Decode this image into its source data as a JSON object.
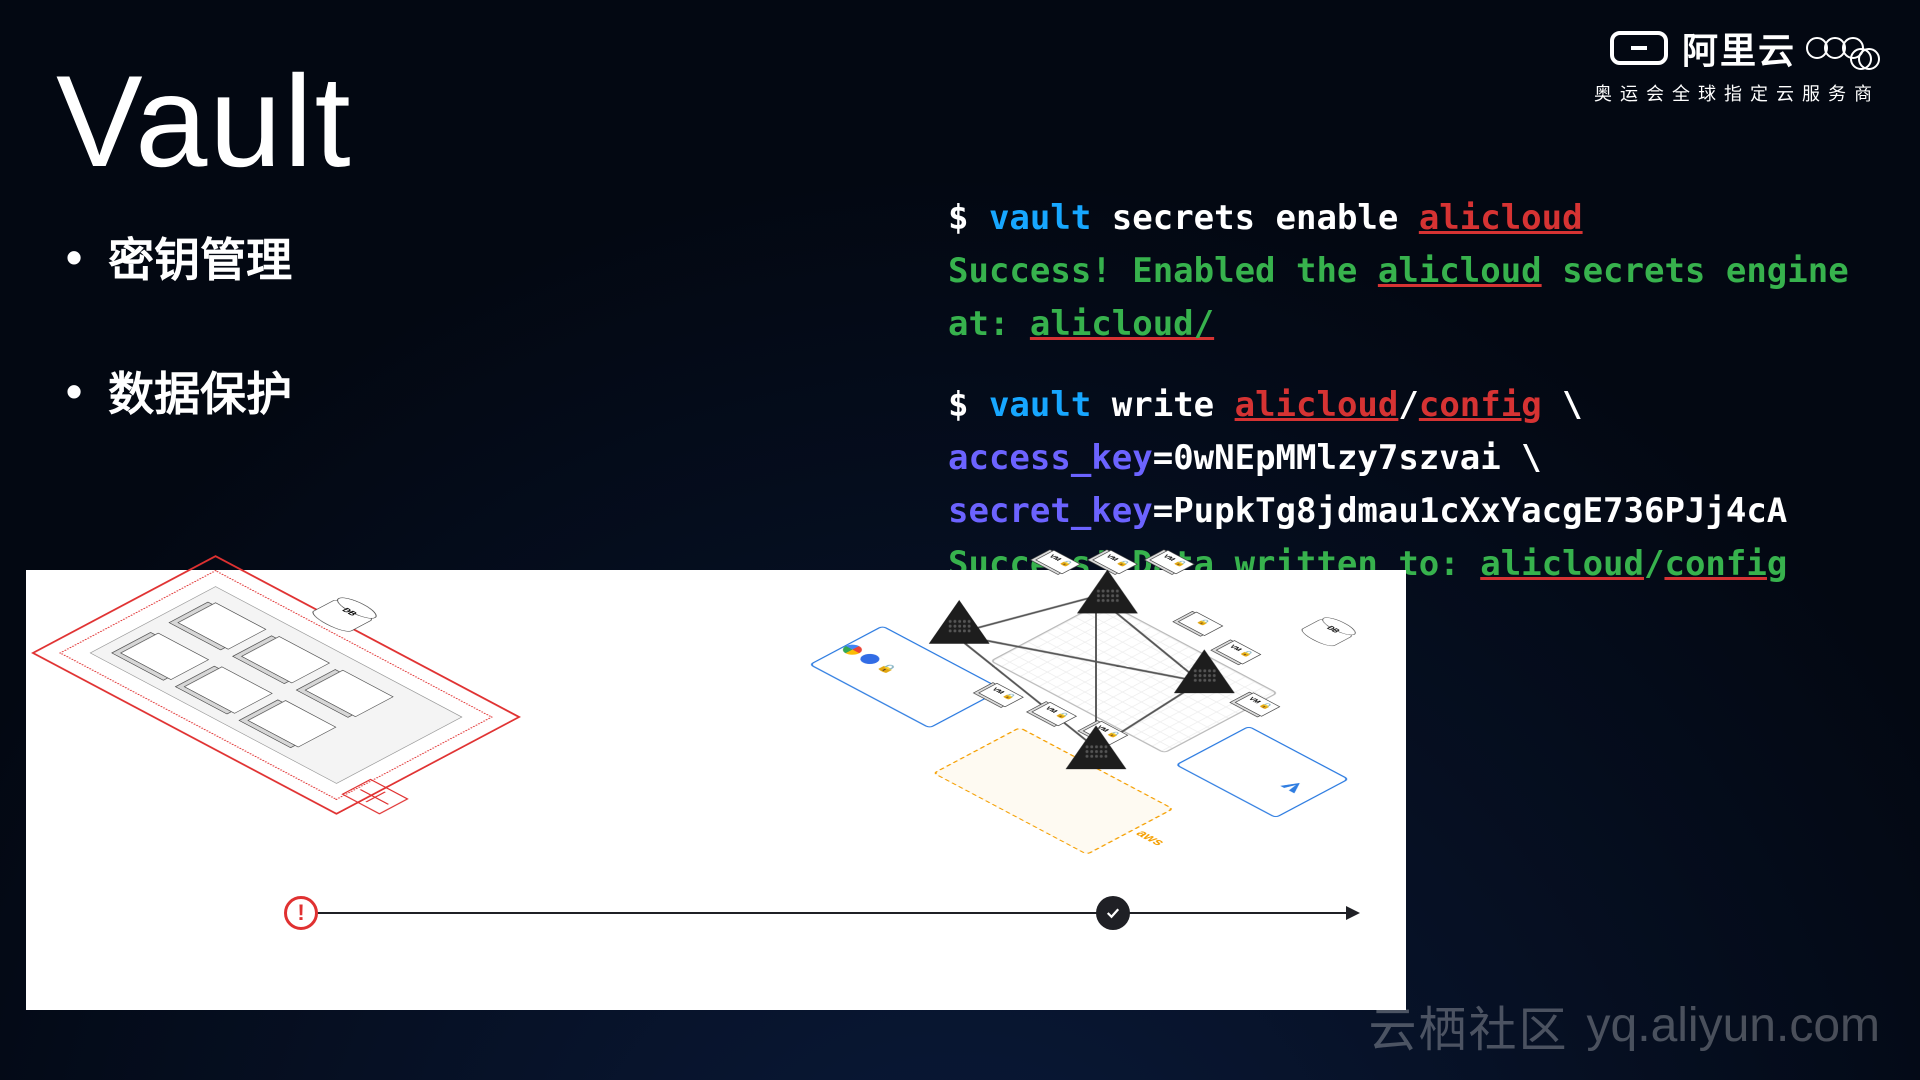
{
  "title": "Vault",
  "bullets": [
    "密钥管理",
    "数据保护"
  ],
  "terminal": {
    "line1": {
      "prompt": "$ ",
      "cmd": "vault",
      "rest": " secrets enable ",
      "ali": "alicloud"
    },
    "line2": {
      "pre": "Success! Enabled the ",
      "ali": "alicloud",
      "post": " secrets engine at: ",
      "ali2": "alicloud/"
    },
    "line3": {
      "prompt": "$ ",
      "cmd": "vault",
      "rest": " write ",
      "ali": "alicloud",
      "slash": "/",
      "cfg": "config",
      "cont": " \\"
    },
    "line4": {
      "indent": "        ",
      "key": "access_key",
      "eq": "=",
      "val": "0wNEpMMlzy7szvai",
      "cont": " \\"
    },
    "line5": {
      "indent": "        ",
      "key": "secret_key",
      "eq": "=",
      "val": "PupkTg8jdmau1cXxYacgE736PJj4cA"
    },
    "line6": {
      "pre": "Success! Data written to: ",
      "ali": "alicloud",
      "slash": "/",
      "cfg": "config"
    }
  },
  "logo": {
    "brand": "阿里云",
    "tagline": "奥运会全球指定云服务商"
  },
  "watermark": {
    "cn": "云栖社区",
    "url": "yq.aliyun.com"
  },
  "diagram": {
    "db_label": "DB",
    "vm_label": "VM",
    "aws_label": "aws",
    "stop_a": "!",
    "gcp_color1": "#ea4335",
    "gcp_color2": "#4285f4"
  }
}
